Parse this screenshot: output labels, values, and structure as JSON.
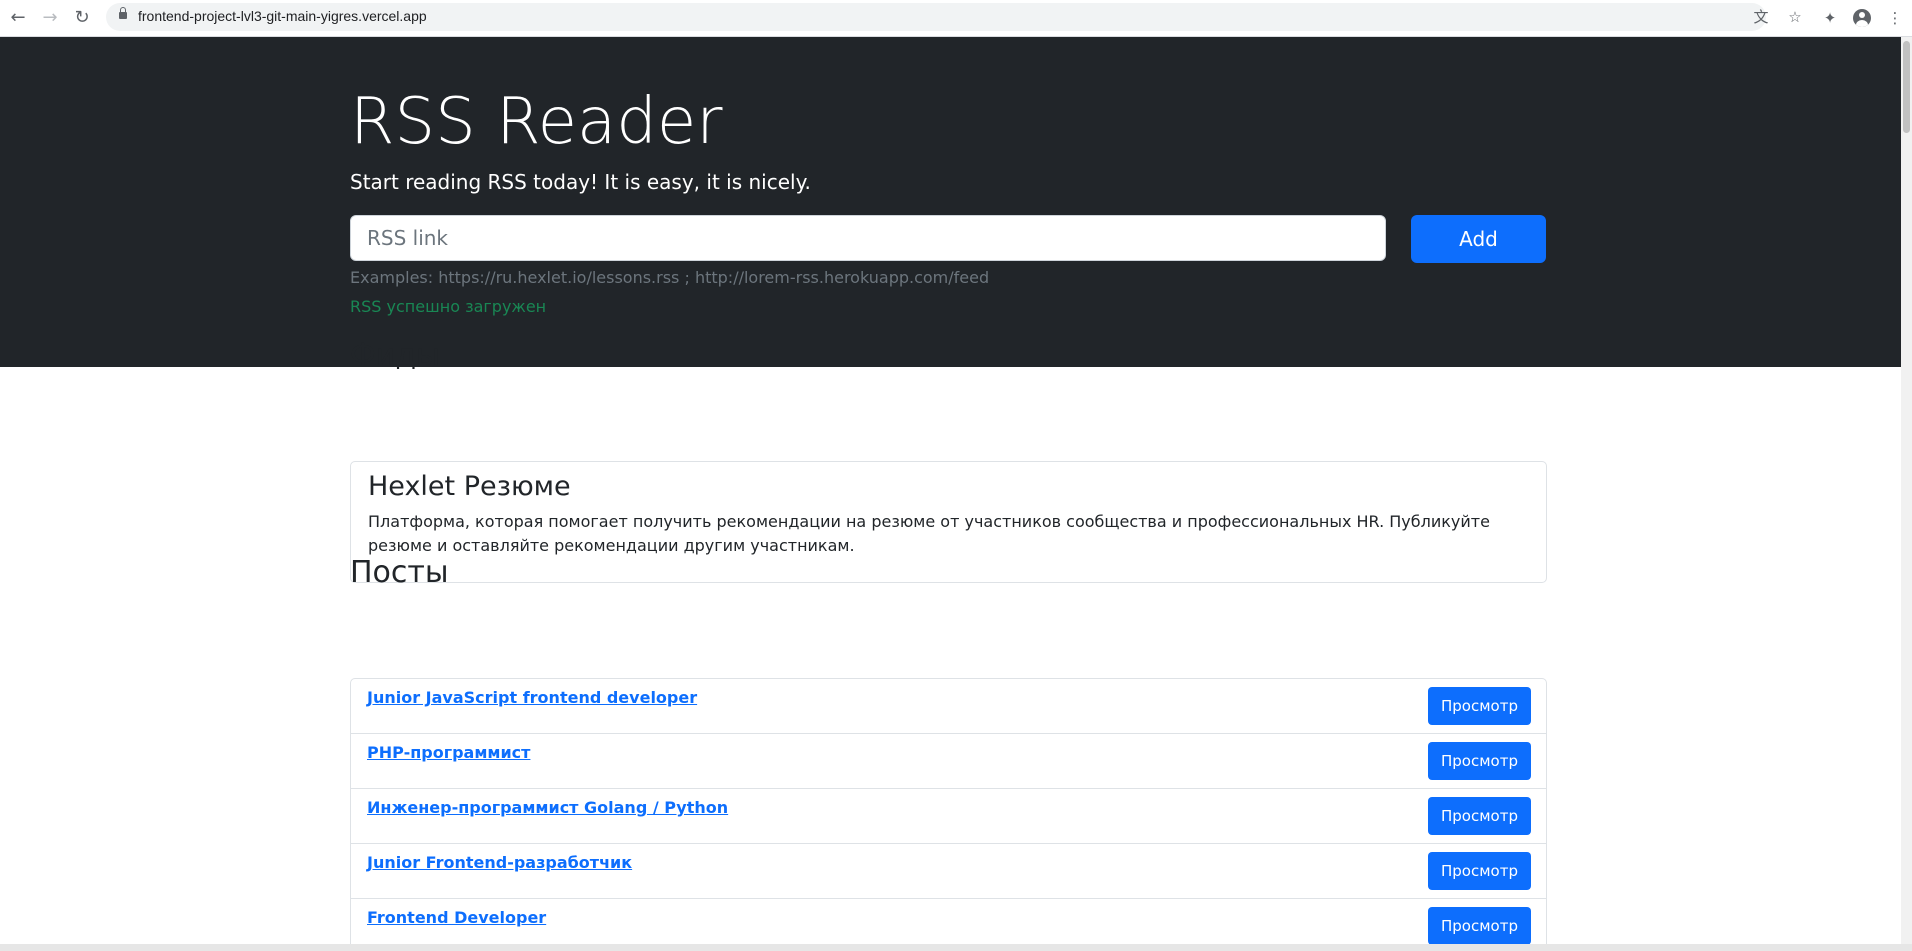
{
  "browser": {
    "url": "frontend-project-lvl3-git-main-yigres.vercel.app"
  },
  "hero": {
    "title": "RSS Reader",
    "lead": "Start reading RSS today! It is easy, it is nicely.",
    "input_placeholder": "RSS link",
    "add_label": "Add",
    "examples": "Examples: https://ru.hexlet.io/lessons.rss ; http://lorem-rss.herokuapp.com/feed",
    "feedback": "RSS успешно загружен"
  },
  "feeds": {
    "heading": "Фиды",
    "items": [
      {
        "title": "Hexlet Резюме",
        "description": "Платформа, которая помогает получить рекомендации на резюме от участников сообщества и профессиональных HR. Публикуйте резюме и оставляйте рекомендации другим участникам."
      }
    ]
  },
  "posts": {
    "heading": "Посты",
    "items": [
      {
        "title": "Junior JavaScript frontend developer",
        "button": "Просмотр"
      },
      {
        "title": "PHP-программист",
        "button": "Просмотр"
      },
      {
        "title": "Инженер-программист Golang / Python",
        "button": "Просмотр"
      },
      {
        "title": "Junior Frontend-разработчик",
        "button": "Просмотр"
      },
      {
        "title": "Frontend Developer",
        "button": "Просмотр"
      }
    ]
  },
  "colors": {
    "hero_bg": "#212529",
    "primary": "#0d6efd",
    "success": "#198754",
    "muted": "#6c757d"
  },
  "icons": [
    "back-arrow-icon",
    "forward-arrow-icon",
    "reload-icon",
    "lock-icon",
    "translate-icon",
    "star-icon",
    "extensions-icon",
    "profile-icon",
    "menu-icon"
  ]
}
